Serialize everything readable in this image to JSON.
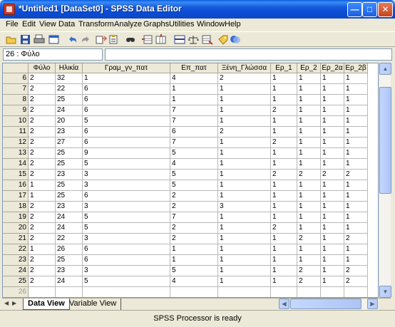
{
  "window": {
    "title": "*Untitled1 [DataSet0] - SPSS Data Editor"
  },
  "menu": [
    "File",
    "Edit",
    "View",
    "Data",
    "Transform",
    "Analyze",
    "Graphs",
    "Utilities",
    "Window",
    "Help"
  ],
  "toolbar_icons": [
    "open-icon",
    "save-icon",
    "print-icon",
    "dialog-recall-icon",
    "undo-icon",
    "redo-icon",
    "goto-case-icon",
    "variables-icon",
    "find-icon",
    "insert-cases-icon",
    "insert-variable-icon",
    "split-file-icon",
    "weight-cases-icon",
    "select-cases-icon",
    "value-labels-icon",
    "use-sets-icon"
  ],
  "cell_editor": {
    "reference": "26 : Φύλο",
    "value": ""
  },
  "grid": {
    "columns": [
      "Φύλο",
      "Ηλικία",
      "Γραμ_γν_πατ",
      "Επ_πατ",
      "Ξένη_Γλώσσα",
      "Ερ_1",
      "Ερ_2",
      "Ερ_2α",
      "Ερ_2β"
    ],
    "rows": [
      {
        "n": "6",
        "c": [
          "2",
          "32",
          "1",
          "4",
          "2",
          "1",
          "1",
          "1",
          "1"
        ]
      },
      {
        "n": "7",
        "c": [
          "2",
          "22",
          "6",
          "1",
          "1",
          "1",
          "1",
          "1",
          "1"
        ]
      },
      {
        "n": "8",
        "c": [
          "2",
          "25",
          "6",
          "1",
          "1",
          "1",
          "1",
          "1",
          "1"
        ]
      },
      {
        "n": "9",
        "c": [
          "2",
          "24",
          "6",
          "7",
          "1",
          "2",
          "1",
          "1",
          "1"
        ]
      },
      {
        "n": "10",
        "c": [
          "2",
          "20",
          "5",
          "7",
          "1",
          "1",
          "1",
          "1",
          "1"
        ]
      },
      {
        "n": "11",
        "c": [
          "2",
          "23",
          "6",
          "6",
          "2",
          "1",
          "1",
          "1",
          "1"
        ]
      },
      {
        "n": "12",
        "c": [
          "2",
          "27",
          "6",
          "7",
          "1",
          "2",
          "1",
          "1",
          "1"
        ]
      },
      {
        "n": "13",
        "c": [
          "2",
          "25",
          "9",
          "5",
          "1",
          "1",
          "1",
          "1",
          "1"
        ]
      },
      {
        "n": "14",
        "c": [
          "2",
          "25",
          "5",
          "4",
          "1",
          "1",
          "1",
          "1",
          "1"
        ]
      },
      {
        "n": "15",
        "c": [
          "2",
          "23",
          "3",
          "5",
          "1",
          "2",
          "2",
          "2",
          "2"
        ]
      },
      {
        "n": "16",
        "c": [
          "1",
          "25",
          "3",
          "5",
          "1",
          "1",
          "1",
          "1",
          "1"
        ]
      },
      {
        "n": "17",
        "c": [
          "1",
          "25",
          "6",
          "2",
          "1",
          "1",
          "1",
          "1",
          "1"
        ]
      },
      {
        "n": "18",
        "c": [
          "2",
          "23",
          "3",
          "2",
          "3",
          "1",
          "1",
          "1",
          "1"
        ]
      },
      {
        "n": "19",
        "c": [
          "2",
          "24",
          "5",
          "7",
          "1",
          "1",
          "1",
          "1",
          "1"
        ]
      },
      {
        "n": "20",
        "c": [
          "2",
          "24",
          "5",
          "2",
          "1",
          "2",
          "1",
          "1",
          "1"
        ]
      },
      {
        "n": "21",
        "c": [
          "2",
          "22",
          "3",
          "2",
          "1",
          "1",
          "2",
          "1",
          "2"
        ]
      },
      {
        "n": "22",
        "c": [
          "1",
          "26",
          "6",
          "1",
          "1",
          "1",
          "1",
          "1",
          "1"
        ]
      },
      {
        "n": "23",
        "c": [
          "2",
          "25",
          "6",
          "1",
          "1",
          "1",
          "1",
          "1",
          "1"
        ]
      },
      {
        "n": "24",
        "c": [
          "2",
          "23",
          "3",
          "5",
          "1",
          "1",
          "2",
          "1",
          "2"
        ]
      },
      {
        "n": "25",
        "c": [
          "2",
          "24",
          "5",
          "4",
          "1",
          "1",
          "2",
          "1",
          "2"
        ]
      },
      {
        "n": "26",
        "c": [
          "",
          "",
          "",
          "",
          "",
          "",
          "",
          "",
          ""
        ]
      }
    ]
  },
  "tabs": {
    "data_view": "Data View",
    "variable_view": "Variable View"
  },
  "status": {
    "text": "SPSS Processor  is ready"
  }
}
